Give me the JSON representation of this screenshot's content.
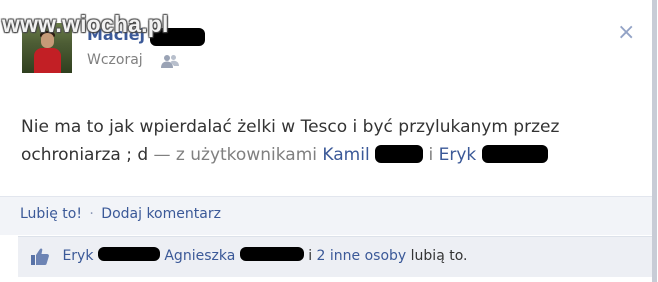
{
  "watermark": "www.wiocha.pl",
  "post": {
    "author_visible": "Maciej",
    "timestamp": "Wczoraj",
    "audience_icon": "friends-icon",
    "close_label": "×",
    "text_main": "Nie ma to jak wpierdalać żelki w Tesco i być przylukanym przez ochroniarza ; d",
    "text_with": "— z użytkownikami",
    "tagged": [
      "Kamil",
      "Eryk"
    ],
    "conjunction": "i"
  },
  "actions": {
    "like": "Lubię to!",
    "separator": "·",
    "comment": "Dodaj komentarz"
  },
  "likes": {
    "icon": "thumbs-up-icon",
    "names": [
      "Eryk",
      "Agnieszka"
    ],
    "conjunction": "i",
    "others": "2 inne osoby",
    "suffix": "lubią to."
  },
  "colors": {
    "link": "#3b5998",
    "muted": "#808080",
    "actions_bg": "#f2f4f8",
    "likes_bg": "#edeff4"
  }
}
